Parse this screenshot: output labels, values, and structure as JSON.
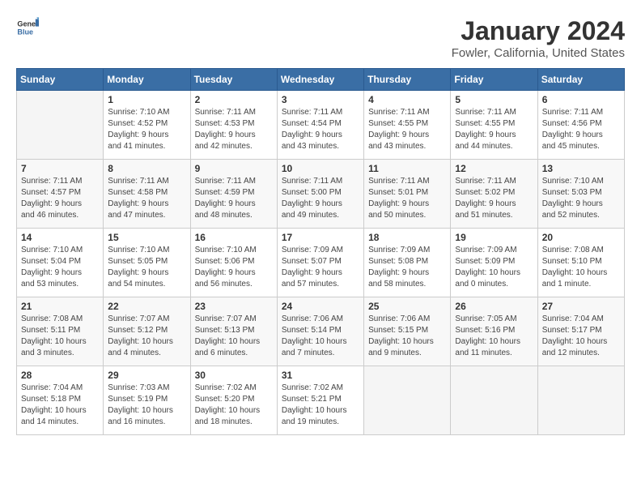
{
  "header": {
    "logo_general": "General",
    "logo_blue": "Blue",
    "title": "January 2024",
    "location": "Fowler, California, United States"
  },
  "days_of_week": [
    "Sunday",
    "Monday",
    "Tuesday",
    "Wednesday",
    "Thursday",
    "Friday",
    "Saturday"
  ],
  "weeks": [
    [
      {
        "day": "",
        "info": ""
      },
      {
        "day": "1",
        "info": "Sunrise: 7:10 AM\nSunset: 4:52 PM\nDaylight: 9 hours\nand 41 minutes."
      },
      {
        "day": "2",
        "info": "Sunrise: 7:11 AM\nSunset: 4:53 PM\nDaylight: 9 hours\nand 42 minutes."
      },
      {
        "day": "3",
        "info": "Sunrise: 7:11 AM\nSunset: 4:54 PM\nDaylight: 9 hours\nand 43 minutes."
      },
      {
        "day": "4",
        "info": "Sunrise: 7:11 AM\nSunset: 4:55 PM\nDaylight: 9 hours\nand 43 minutes."
      },
      {
        "day": "5",
        "info": "Sunrise: 7:11 AM\nSunset: 4:55 PM\nDaylight: 9 hours\nand 44 minutes."
      },
      {
        "day": "6",
        "info": "Sunrise: 7:11 AM\nSunset: 4:56 PM\nDaylight: 9 hours\nand 45 minutes."
      }
    ],
    [
      {
        "day": "7",
        "info": "Sunrise: 7:11 AM\nSunset: 4:57 PM\nDaylight: 9 hours\nand 46 minutes."
      },
      {
        "day": "8",
        "info": "Sunrise: 7:11 AM\nSunset: 4:58 PM\nDaylight: 9 hours\nand 47 minutes."
      },
      {
        "day": "9",
        "info": "Sunrise: 7:11 AM\nSunset: 4:59 PM\nDaylight: 9 hours\nand 48 minutes."
      },
      {
        "day": "10",
        "info": "Sunrise: 7:11 AM\nSunset: 5:00 PM\nDaylight: 9 hours\nand 49 minutes."
      },
      {
        "day": "11",
        "info": "Sunrise: 7:11 AM\nSunset: 5:01 PM\nDaylight: 9 hours\nand 50 minutes."
      },
      {
        "day": "12",
        "info": "Sunrise: 7:11 AM\nSunset: 5:02 PM\nDaylight: 9 hours\nand 51 minutes."
      },
      {
        "day": "13",
        "info": "Sunrise: 7:10 AM\nSunset: 5:03 PM\nDaylight: 9 hours\nand 52 minutes."
      }
    ],
    [
      {
        "day": "14",
        "info": "Sunrise: 7:10 AM\nSunset: 5:04 PM\nDaylight: 9 hours\nand 53 minutes."
      },
      {
        "day": "15",
        "info": "Sunrise: 7:10 AM\nSunset: 5:05 PM\nDaylight: 9 hours\nand 54 minutes."
      },
      {
        "day": "16",
        "info": "Sunrise: 7:10 AM\nSunset: 5:06 PM\nDaylight: 9 hours\nand 56 minutes."
      },
      {
        "day": "17",
        "info": "Sunrise: 7:09 AM\nSunset: 5:07 PM\nDaylight: 9 hours\nand 57 minutes."
      },
      {
        "day": "18",
        "info": "Sunrise: 7:09 AM\nSunset: 5:08 PM\nDaylight: 9 hours\nand 58 minutes."
      },
      {
        "day": "19",
        "info": "Sunrise: 7:09 AM\nSunset: 5:09 PM\nDaylight: 10 hours\nand 0 minutes."
      },
      {
        "day": "20",
        "info": "Sunrise: 7:08 AM\nSunset: 5:10 PM\nDaylight: 10 hours\nand 1 minute."
      }
    ],
    [
      {
        "day": "21",
        "info": "Sunrise: 7:08 AM\nSunset: 5:11 PM\nDaylight: 10 hours\nand 3 minutes."
      },
      {
        "day": "22",
        "info": "Sunrise: 7:07 AM\nSunset: 5:12 PM\nDaylight: 10 hours\nand 4 minutes."
      },
      {
        "day": "23",
        "info": "Sunrise: 7:07 AM\nSunset: 5:13 PM\nDaylight: 10 hours\nand 6 minutes."
      },
      {
        "day": "24",
        "info": "Sunrise: 7:06 AM\nSunset: 5:14 PM\nDaylight: 10 hours\nand 7 minutes."
      },
      {
        "day": "25",
        "info": "Sunrise: 7:06 AM\nSunset: 5:15 PM\nDaylight: 10 hours\nand 9 minutes."
      },
      {
        "day": "26",
        "info": "Sunrise: 7:05 AM\nSunset: 5:16 PM\nDaylight: 10 hours\nand 11 minutes."
      },
      {
        "day": "27",
        "info": "Sunrise: 7:04 AM\nSunset: 5:17 PM\nDaylight: 10 hours\nand 12 minutes."
      }
    ],
    [
      {
        "day": "28",
        "info": "Sunrise: 7:04 AM\nSunset: 5:18 PM\nDaylight: 10 hours\nand 14 minutes."
      },
      {
        "day": "29",
        "info": "Sunrise: 7:03 AM\nSunset: 5:19 PM\nDaylight: 10 hours\nand 16 minutes."
      },
      {
        "day": "30",
        "info": "Sunrise: 7:02 AM\nSunset: 5:20 PM\nDaylight: 10 hours\nand 18 minutes."
      },
      {
        "day": "31",
        "info": "Sunrise: 7:02 AM\nSunset: 5:21 PM\nDaylight: 10 hours\nand 19 minutes."
      },
      {
        "day": "",
        "info": ""
      },
      {
        "day": "",
        "info": ""
      },
      {
        "day": "",
        "info": ""
      }
    ]
  ]
}
